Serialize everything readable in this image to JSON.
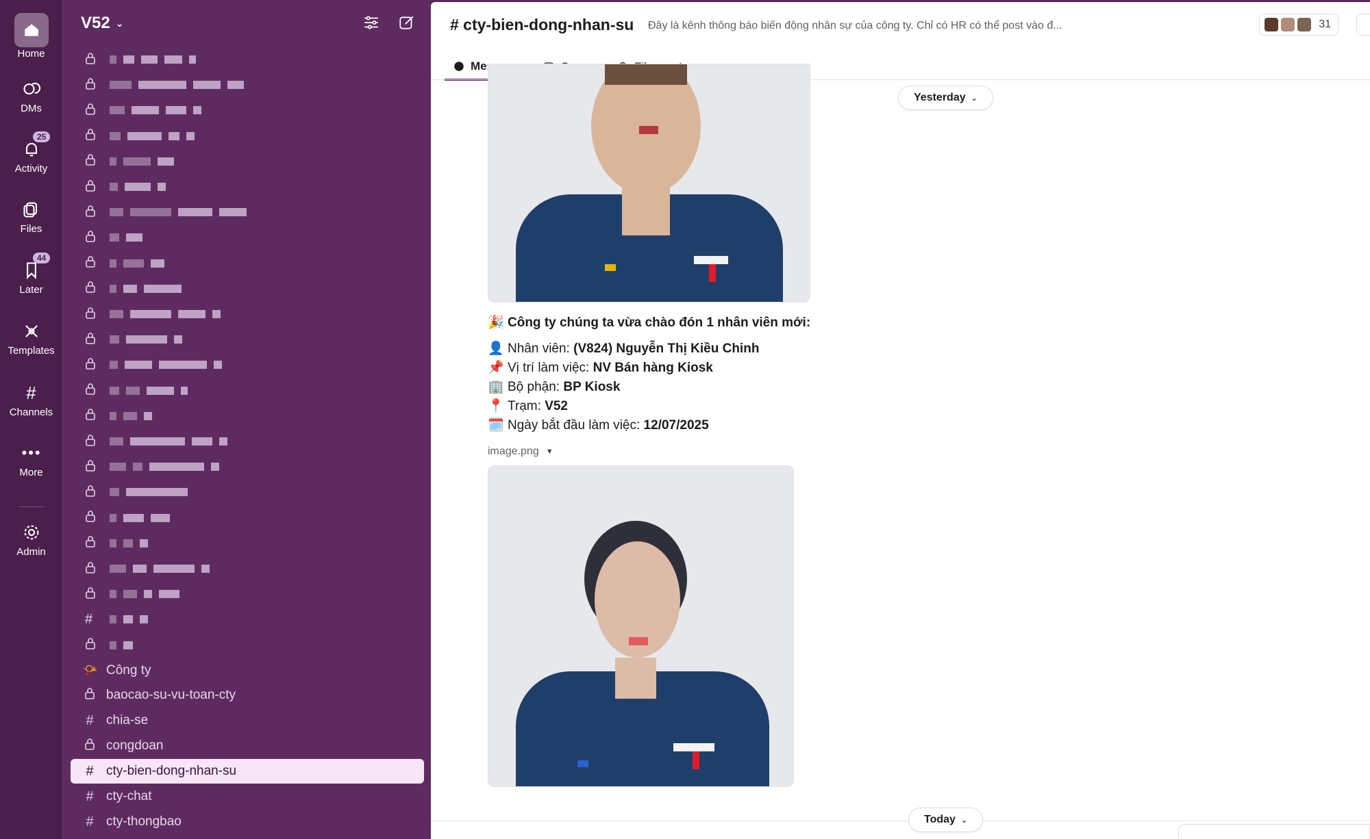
{
  "rail": {
    "home": "Home",
    "dms": "DMs",
    "activity": "Activity",
    "activity_badge": "25",
    "files": "Files",
    "later": "Later",
    "later_badge": "44",
    "templates": "Templates",
    "channels": "Channels",
    "more": "More",
    "admin": "Admin"
  },
  "sidebar": {
    "workspace": "V52",
    "section_label": "Công ty",
    "channels": [
      {
        "name": "baocao-su-vu-toan-cty",
        "icon": "lock-icon"
      },
      {
        "name": "chia-se",
        "icon": "hash-icon"
      },
      {
        "name": "congdoan",
        "icon": "lock-icon"
      },
      {
        "name": "cty-bien-dong-nhan-su",
        "icon": "hash-icon",
        "active": true
      },
      {
        "name": "cty-chat",
        "icon": "hash-icon"
      },
      {
        "name": "cty-thongbao",
        "icon": "hash-icon"
      }
    ]
  },
  "channel": {
    "title": "# cty-bien-dong-nhan-su",
    "description": "Đây là kênh thông báo biến động nhân sự của công ty. Chỉ có HR có thể post vào đ...",
    "member_count": "31",
    "tabs": [
      "Messages",
      "Canvas",
      "Files"
    ]
  },
  "messages": {
    "date_yesterday": "Yesterday",
    "date_today": "Today",
    "intro": "Công ty chúng ta vừa chào đón 1 nhân viên mới:",
    "employee_label": "Nhân viên:",
    "employee_value": "(V824) Nguyễn Thị Kiều Chinh",
    "position_label": "Vị trí làm việc:",
    "position_value": "NV Bán hàng Kiosk",
    "dept_label": "Bộ phận:",
    "dept_value": "BP Kiosk",
    "station_label": "Trạm:",
    "station_value": "V52",
    "start_label": "Ngày bắt đầu làm việc:",
    "start_value": "12/07/2025",
    "attachment": "image.png"
  },
  "colors": {
    "rail_bg": "#4a1f4c",
    "sidebar_bg": "#5e2b61",
    "active_channel_bg": "#f6e6f6",
    "accent": "#611f69"
  }
}
